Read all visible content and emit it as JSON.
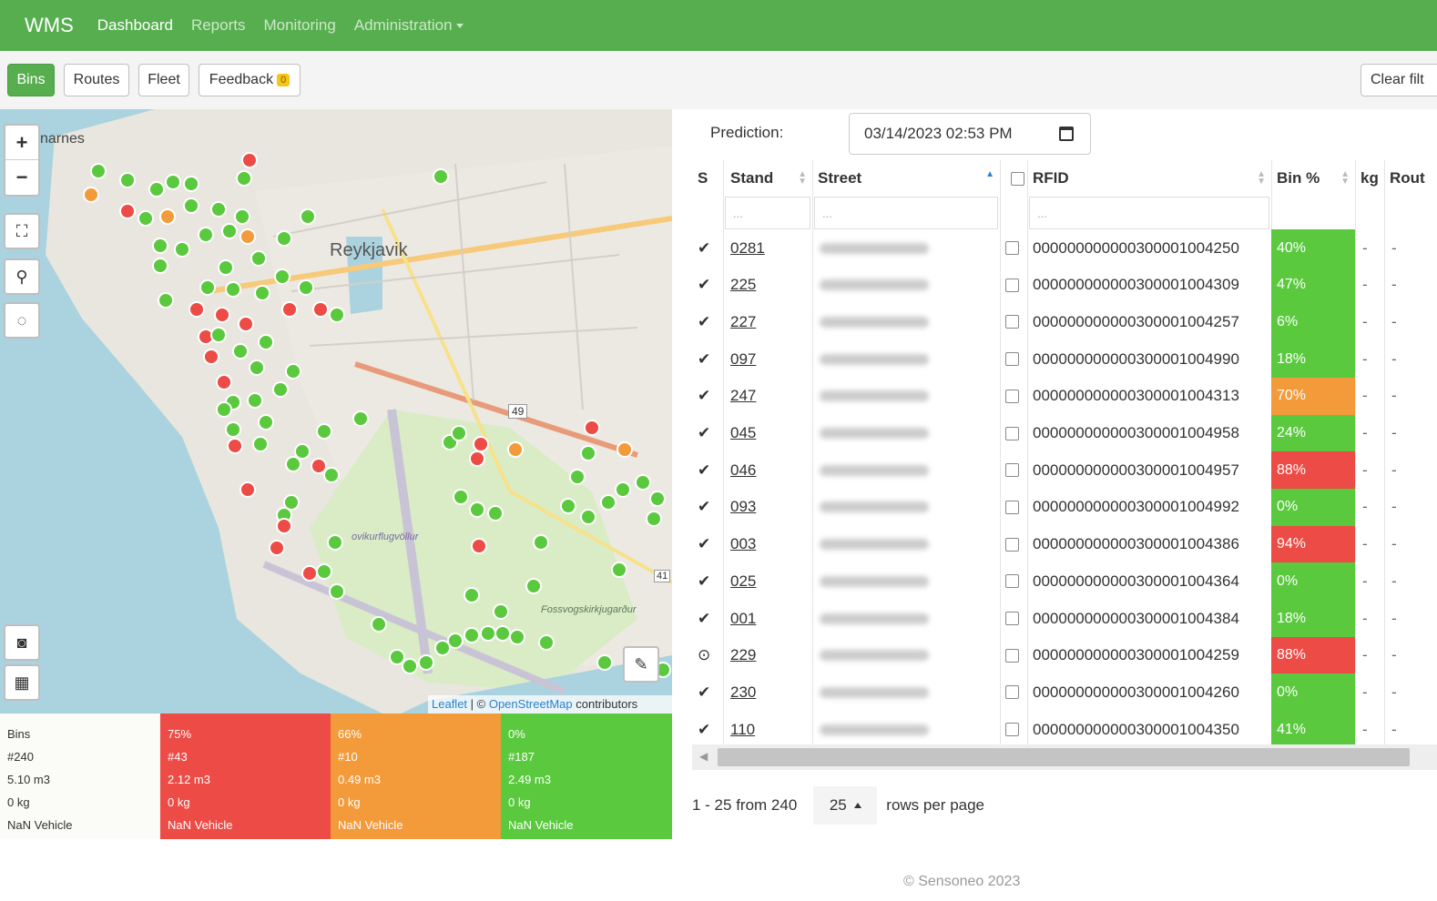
{
  "nav": {
    "brand": "WMS",
    "links": [
      "Dashboard",
      "Reports",
      "Monitoring",
      "Administration"
    ]
  },
  "subnav": {
    "tabs": [
      "Bins",
      "Routes",
      "Fleet",
      "Feedback"
    ],
    "feedback_count": "0",
    "clear_label": "Clear filt"
  },
  "map": {
    "labels": [
      "narnes",
      "Reykjavik",
      "49",
      "Fossvogskirkjugarður",
      "ovikurflugvöllur",
      "41"
    ],
    "attribution": {
      "leaflet": "Leaflet",
      "sep": " | © ",
      "osm": "OpenStreetMap",
      "rest": " contributors"
    },
    "icons": [
      "zoom-in-icon",
      "zoom-out-icon",
      "fullscreen-icon",
      "locate-icon",
      "lasso-icon",
      "camera-icon",
      "layout-icon",
      "measure-icon"
    ]
  },
  "legend": {
    "all": {
      "title": "Bins",
      "count": "#240",
      "volume": "5.10 m3",
      "weight": "0 kg",
      "vehicle": "NaN Vehicle"
    },
    "high": {
      "title": "75%",
      "count": "#43",
      "volume": "2.12 m3",
      "weight": "0 kg",
      "vehicle": "NaN Vehicle"
    },
    "mid": {
      "title": "66%",
      "count": "#10",
      "volume": "0.49 m3",
      "weight": "0 kg",
      "vehicle": "NaN Vehicle"
    },
    "low": {
      "title": "0%",
      "count": "#187",
      "volume": "2.49 m3",
      "weight": "0 kg",
      "vehicle": "NaN Vehicle"
    }
  },
  "prediction": {
    "label": "Prediction:",
    "value": "03/14/2023 02:53 PM"
  },
  "table": {
    "columns": [
      "S",
      "Stand",
      "Street",
      "RFID",
      "Bin %",
      "kg",
      "Rout"
    ],
    "filter_placeholder": "...",
    "rows": [
      {
        "s": "✔",
        "stand": "0281",
        "rfid": "000000000000300001004250",
        "pct": "40%",
        "kg": "-",
        "route": "-",
        "level": "green"
      },
      {
        "s": "✔",
        "stand": "225",
        "rfid": "000000000000300001004309",
        "pct": "47%",
        "kg": "-",
        "route": "-",
        "level": "green"
      },
      {
        "s": "✔",
        "stand": "227",
        "rfid": "000000000000300001004257",
        "pct": "6%",
        "kg": "-",
        "route": "-",
        "level": "green"
      },
      {
        "s": "✔",
        "stand": "097",
        "rfid": "000000000000300001004990",
        "pct": "18%",
        "kg": "-",
        "route": "-",
        "level": "green"
      },
      {
        "s": "✔",
        "stand": "247",
        "rfid": "000000000000300001004313",
        "pct": "70%",
        "kg": "-",
        "route": "-",
        "level": "orange"
      },
      {
        "s": "✔",
        "stand": "045",
        "rfid": "000000000000300001004958",
        "pct": "24%",
        "kg": "-",
        "route": "-",
        "level": "green"
      },
      {
        "s": "✔",
        "stand": "046",
        "rfid": "000000000000300001004957",
        "pct": "88%",
        "kg": "-",
        "route": "-",
        "level": "red"
      },
      {
        "s": "✔",
        "stand": "093",
        "rfid": "000000000000300001004992",
        "pct": "0%",
        "kg": "-",
        "route": "-",
        "level": "green"
      },
      {
        "s": "✔",
        "stand": "003",
        "rfid": "000000000000300001004386",
        "pct": "94%",
        "kg": "-",
        "route": "-",
        "level": "red"
      },
      {
        "s": "✔",
        "stand": "025",
        "rfid": "000000000000300001004364",
        "pct": "0%",
        "kg": "-",
        "route": "-",
        "level": "green"
      },
      {
        "s": "✔",
        "stand": "001",
        "rfid": "000000000000300001004384",
        "pct": "18%",
        "kg": "-",
        "route": "-",
        "level": "green"
      },
      {
        "s": "⊙",
        "stand": "229",
        "rfid": "000000000000300001004259",
        "pct": "88%",
        "kg": "-",
        "route": "-",
        "level": "red"
      },
      {
        "s": "✔",
        "stand": "230",
        "rfid": "000000000000300001004260",
        "pct": "0%",
        "kg": "-",
        "route": "-",
        "level": "green"
      },
      {
        "s": "✔",
        "stand": "110",
        "rfid": "000000000000300001004350",
        "pct": "41%",
        "kg": "-",
        "route": "-",
        "level": "green"
      }
    ]
  },
  "pager": {
    "range": "1 - 25 from 240",
    "size": "25",
    "suffix": "rows per page"
  },
  "footer": "© Sensoneo 2023",
  "colors": {
    "green": "#5ac93e",
    "orange": "#f39a3a",
    "red": "#ed4b45",
    "brand": "#56ae4e"
  }
}
